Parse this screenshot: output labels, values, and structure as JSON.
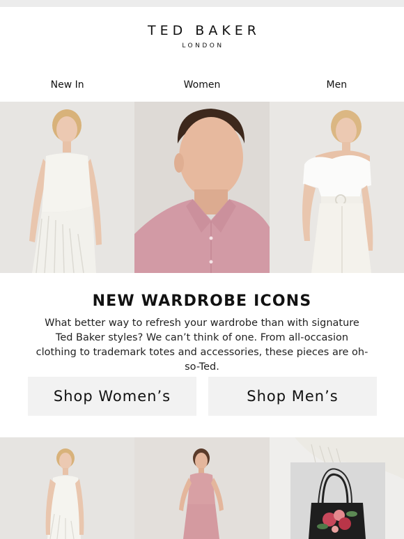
{
  "brand": {
    "name": "TED BAKER",
    "subline": "LONDON"
  },
  "nav": [
    {
      "label": "New In"
    },
    {
      "label": "Women"
    },
    {
      "label": "Men"
    }
  ],
  "hero": {
    "images": [
      {
        "alt": "woman-white-dress"
      },
      {
        "alt": "man-pink-shirt"
      },
      {
        "alt": "woman-white-top-trousers"
      }
    ]
  },
  "promo": {
    "headline": "NEW WARDROBE ICONS",
    "body": "What better way to refresh your wardrobe than with signature Ted Baker styles? We can’t think of one. From all-occasion clothing to trademark totes and accessories, these pieces are oh-so-Ted."
  },
  "buttons": {
    "women": "Shop Women’s",
    "men": "Shop Men’s"
  },
  "bottom": {
    "images": [
      {
        "alt": "woman-white-dress-full"
      },
      {
        "alt": "woman-pink-top-skirt"
      },
      {
        "alt": "black-floral-tote-bag"
      }
    ]
  }
}
